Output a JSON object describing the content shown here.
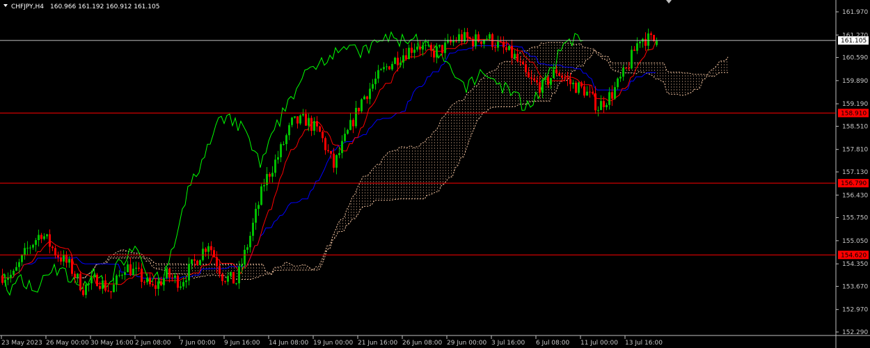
{
  "header": {
    "symbol": "CHFJPY,H4",
    "ohlc": "160.966 161.192 160.912 161.105"
  },
  "colors": {
    "background": "#000000",
    "bull_candle": "#00c000",
    "bear_candle": "#ff0000",
    "tenkan": "#ff0000",
    "kijun": "#0000ff",
    "chikou": "#00ff00",
    "cloud": "#f4c4a0",
    "level_line": "#ff0000",
    "price_line": "#c0c0c0",
    "axis_text": "#c8c8c8"
  },
  "chart_data": {
    "type": "candlestick",
    "indicator": "Ichimoku Kinko Hyo",
    "y_ticks": [
      "161.970",
      "161.270",
      "160.590",
      "159.890",
      "159.190",
      "158.510",
      "157.810",
      "157.130",
      "156.430",
      "155.750",
      "155.050",
      "154.350",
      "153.670",
      "152.970",
      "152.290"
    ],
    "ylim": [
      152.29,
      161.97
    ],
    "x_ticks": [
      "23 May 2023",
      "26 May 00:00",
      "30 May 16:00",
      "2 Jun 08:00",
      "7 Jun 00:00",
      "9 Jun 16:00",
      "14 Jun 08:00",
      "19 Jun 00:00",
      "21 Jun 16:00",
      "26 Jun 08:00",
      "29 Jun 00:00",
      "3 Jul 16:00",
      "6 Jul 08:00",
      "11 Jul 00:00",
      "13 Jul 16:00"
    ],
    "current_price": 161.105,
    "current_price_label": "161.105",
    "levels": [
      {
        "value": 158.91,
        "label": "158.910"
      },
      {
        "value": 156.79,
        "label": "156.790"
      },
      {
        "value": 154.62,
        "label": "154.620"
      }
    ],
    "close_path": [
      [
        0,
        154.0
      ],
      [
        5,
        154.0
      ],
      [
        10,
        154.8
      ],
      [
        15,
        155.3
      ],
      [
        20,
        154.7
      ],
      [
        25,
        154.3
      ],
      [
        30,
        153.6
      ],
      [
        35,
        153.9
      ],
      [
        40,
        153.5
      ],
      [
        45,
        154.3
      ],
      [
        50,
        154.0
      ],
      [
        55,
        153.6
      ],
      [
        60,
        154.0
      ],
      [
        65,
        153.8
      ],
      [
        70,
        154.4
      ],
      [
        75,
        155.0
      ],
      [
        80,
        154.0
      ],
      [
        85,
        153.8
      ],
      [
        90,
        155.2
      ],
      [
        95,
        156.8
      ],
      [
        100,
        157.6
      ],
      [
        105,
        158.6
      ],
      [
        110,
        158.7
      ],
      [
        115,
        158.3
      ],
      [
        120,
        157.3
      ],
      [
        125,
        158.3
      ],
      [
        130,
        159.3
      ],
      [
        135,
        159.9
      ],
      [
        140,
        160.4
      ],
      [
        145,
        160.7
      ],
      [
        150,
        161.0
      ],
      [
        155,
        160.7
      ],
      [
        160,
        160.9
      ],
      [
        165,
        161.2
      ],
      [
        170,
        161.1
      ],
      [
        175,
        161.2
      ],
      [
        180,
        160.9
      ],
      [
        185,
        160.6
      ],
      [
        190,
        159.9
      ],
      [
        195,
        159.7
      ],
      [
        200,
        160.2
      ],
      [
        205,
        159.8
      ],
      [
        210,
        159.6
      ],
      [
        215,
        159.1
      ],
      [
        220,
        159.5
      ],
      [
        225,
        160.2
      ],
      [
        230,
        161.2
      ],
      [
        235,
        161.1
      ]
    ]
  }
}
